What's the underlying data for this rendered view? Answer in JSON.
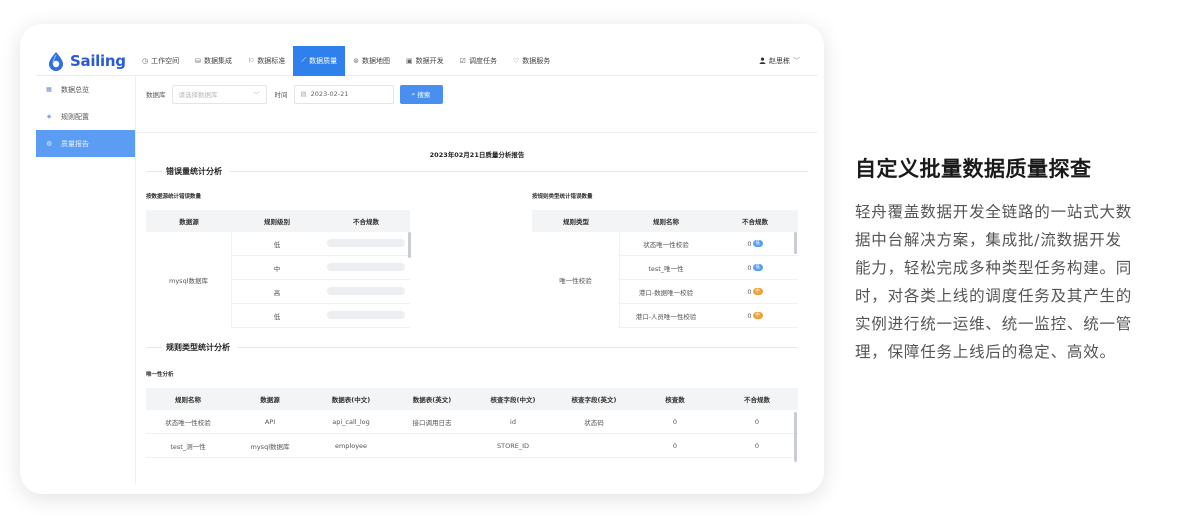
{
  "header": {
    "brand": "Sailing",
    "nav": [
      {
        "icon": "◷",
        "label": "工作空间"
      },
      {
        "icon": "⛁",
        "label": "数据集成"
      },
      {
        "icon": "⚐",
        "label": "数据标准"
      },
      {
        "icon": "⟋",
        "label": "数据质量"
      },
      {
        "icon": "⊚",
        "label": "数据地图"
      },
      {
        "icon": "▣",
        "label": "数据开发"
      },
      {
        "icon": "☑",
        "label": "调度任务"
      },
      {
        "icon": "♡",
        "label": "数据服务"
      }
    ],
    "active_nav": "数据质量",
    "user": "赵思栋"
  },
  "sidebar": {
    "items": [
      {
        "icon": "▦",
        "label": "数据总览"
      },
      {
        "icon": "◈",
        "label": "规则配置"
      },
      {
        "icon": "◍",
        "label": "质量报告"
      }
    ],
    "active": "质量报告"
  },
  "filter": {
    "db_label": "数据库",
    "db_placeholder": "请选择数据库",
    "time_label": "时间",
    "date_value": "2023-02-21",
    "search_label": "搜索"
  },
  "report": {
    "title": "2023年02月21日质量分析报告",
    "section1": "错误量统计分析",
    "left_sub": "按数据源统计错误数量",
    "left_headers": [
      "数据源",
      "规则级别",
      "不合规数"
    ],
    "left_source": "mysql数据库",
    "left_levels": [
      "低",
      "中",
      "高",
      "低"
    ],
    "right_sub": "按规则类型统计错误数量",
    "right_headers": [
      "规则类型",
      "规则名称",
      "不合规数"
    ],
    "right_type": "唯一性校验",
    "right_rows": [
      {
        "name": "状态唯一性校验",
        "count": "0",
        "badge": "低",
        "color": "blue"
      },
      {
        "name": "test_唯一性",
        "count": "0",
        "badge": "低",
        "color": "blue"
      },
      {
        "name": "港口-数据唯一校验",
        "count": "0",
        "badge": "中",
        "color": "orange"
      },
      {
        "name": "港口-人员唯一性校验",
        "count": "0",
        "badge": "中",
        "color": "orange"
      }
    ],
    "section2": "规则类型统计分析",
    "bottom_sub": "唯一性分析",
    "bottom_headers": [
      "规则名称",
      "数据源",
      "数据表(中文)",
      "数据表(英文)",
      "核查字段(中文)",
      "核查字段(英文)",
      "核查数",
      "不合规数"
    ],
    "bottom_rows": [
      [
        "状态唯一性校验",
        "API",
        "api_call_log",
        "接口调用日志",
        "id",
        "状态码",
        "0",
        "0"
      ],
      [
        "test_测一性",
        "mysql数据库",
        "employee",
        "",
        "STORE_ID",
        "",
        "0",
        "0"
      ]
    ]
  },
  "promo": {
    "headline": "自定义批量数据质量探查",
    "lines": [
      "轻舟覆盖数据开发全链路的一站式大数",
      "据中台解决方案，集成批/流数据开发",
      "能力，轻松完成多种类型任务构建。同",
      "时，对各类上线的调度任务及其产生的",
      "实例进行统一运维、统一监控、统一管",
      "理，保障任务上线后的稳定、高效。"
    ]
  }
}
